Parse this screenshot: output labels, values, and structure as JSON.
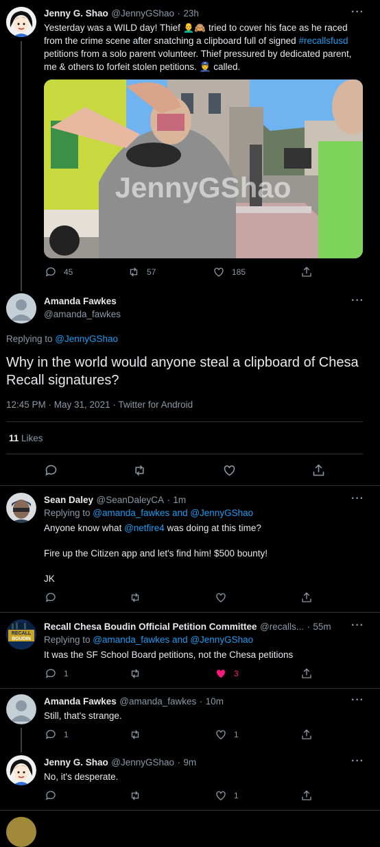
{
  "tweets": [
    {
      "name": "Jenny G. Shao",
      "handle": "@JennyGShao",
      "time": "23h",
      "text_1": "Yesterday was a WILD day! Thief ",
      "text_emoji_1": "👨‍🦲🙈",
      "text_2": " tried to cover his face as he raced from the crime scene after snatching a clipboard full of signed ",
      "hashtag": "#recallsfusd",
      "text_3": " petitions from a solo parent volunteer. Thief pressured by dedicated parent, me & others to forfeit stolen petitions. ",
      "text_emoji_2": "👮",
      "text_4": " called.",
      "image_watermark": "JennyGShao",
      "replies": "45",
      "retweets": "57",
      "likes": "185"
    }
  ],
  "main_tweet": {
    "name": "Amanda Fawkes",
    "handle": "@amanda_fawkes",
    "replying_prefix": "Replying to ",
    "replying_to": "@JennyGShao",
    "text": "Why in the world would anyone steal a clipboard of Chesa Recall signatures?",
    "meta": "12:45 PM · May 31, 2021 · Twitter for Android",
    "likes_count": "11",
    "likes_label": " Likes"
  },
  "replies": [
    {
      "name": "Sean Daley",
      "handle": "@SeanDaleyCA",
      "time": "1m",
      "replying_prefix": "Replying to ",
      "replying_to": "@amanda_fawkes and @JennyGShao",
      "line1_a": "Anyone know what ",
      "line1_mention": "@netfire4",
      "line1_b": " was doing at this time?",
      "line2": "Fire up the Citizen app and let's find him! $500 bounty!",
      "line3": "JK"
    },
    {
      "name": "Recall Chesa Boudin Official Petition Committee",
      "handle": "@recalls...",
      "time": "55m",
      "replying_prefix": "Replying to ",
      "replying_to": "@amanda_fawkes and @JennyGShao",
      "text": "It was the SF School Board petitions, not the Chesa petitions",
      "avatar_text_1": "RECALL",
      "avatar_text_2": "BOUDIN",
      "replies": "1",
      "likes": "3"
    },
    {
      "name": "Amanda Fawkes",
      "handle": "@amanda_fawkes",
      "time": "10m",
      "text": "Still, that's strange.",
      "replies": "1",
      "likes": "1"
    },
    {
      "name": "Jenny G. Shao",
      "handle": "@JennyGShao",
      "time": "9m",
      "text": "No, it's desperate.",
      "likes": "1"
    }
  ],
  "colors": {
    "accent": "#1d9bf0",
    "like": "#f91880",
    "bg": "#000000"
  }
}
